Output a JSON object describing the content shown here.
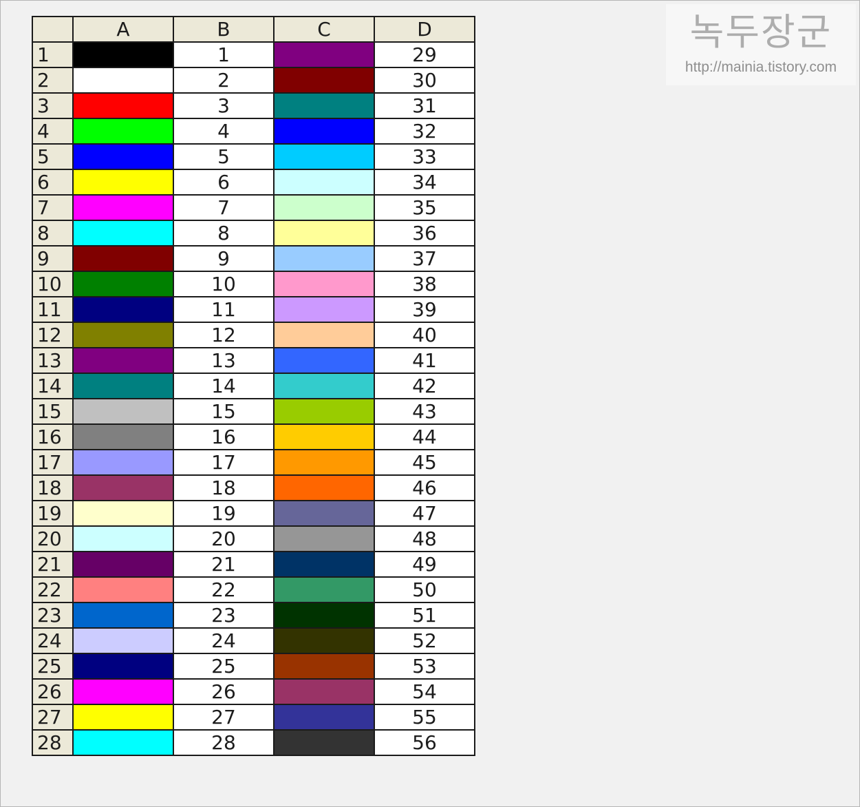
{
  "sheet": {
    "columns": [
      "A",
      "B",
      "C",
      "D"
    ],
    "rows": [
      {
        "n": "1",
        "a_color": "#000000",
        "b": "1",
        "c_color": "#800080",
        "d": "29"
      },
      {
        "n": "2",
        "a_color": "#FFFFFF",
        "b": "2",
        "c_color": "#800000",
        "d": "30"
      },
      {
        "n": "3",
        "a_color": "#FF0000",
        "b": "3",
        "c_color": "#008080",
        "d": "31"
      },
      {
        "n": "4",
        "a_color": "#00FF00",
        "b": "4",
        "c_color": "#0000FF",
        "d": "32"
      },
      {
        "n": "5",
        "a_color": "#0000FF",
        "b": "5",
        "c_color": "#00CCFF",
        "d": "33"
      },
      {
        "n": "6",
        "a_color": "#FFFF00",
        "b": "6",
        "c_color": "#CCFFFF",
        "d": "34"
      },
      {
        "n": "7",
        "a_color": "#FF00FF",
        "b": "7",
        "c_color": "#CCFFCC",
        "d": "35"
      },
      {
        "n": "8",
        "a_color": "#00FFFF",
        "b": "8",
        "c_color": "#FFFF99",
        "d": "36"
      },
      {
        "n": "9",
        "a_color": "#800000",
        "b": "9",
        "c_color": "#99CCFF",
        "d": "37"
      },
      {
        "n": "10",
        "a_color": "#008000",
        "b": "10",
        "c_color": "#FF99CC",
        "d": "38"
      },
      {
        "n": "11",
        "a_color": "#000080",
        "b": "11",
        "c_color": "#CC99FF",
        "d": "39"
      },
      {
        "n": "12",
        "a_color": "#808000",
        "b": "12",
        "c_color": "#FFCC99",
        "d": "40"
      },
      {
        "n": "13",
        "a_color": "#800080",
        "b": "13",
        "c_color": "#3366FF",
        "d": "41"
      },
      {
        "n": "14",
        "a_color": "#008080",
        "b": "14",
        "c_color": "#33CCCC",
        "d": "42"
      },
      {
        "n": "15",
        "a_color": "#C0C0C0",
        "b": "15",
        "c_color": "#99CC00",
        "d": "43"
      },
      {
        "n": "16",
        "a_color": "#808080",
        "b": "16",
        "c_color": "#FFCC00",
        "d": "44"
      },
      {
        "n": "17",
        "a_color": "#9999FF",
        "b": "17",
        "c_color": "#FF9900",
        "d": "45"
      },
      {
        "n": "18",
        "a_color": "#993366",
        "b": "18",
        "c_color": "#FF6600",
        "d": "46"
      },
      {
        "n": "19",
        "a_color": "#FFFFCC",
        "b": "19",
        "c_color": "#666699",
        "d": "47"
      },
      {
        "n": "20",
        "a_color": "#CCFFFF",
        "b": "20",
        "c_color": "#969696",
        "d": "48"
      },
      {
        "n": "21",
        "a_color": "#660066",
        "b": "21",
        "c_color": "#003366",
        "d": "49"
      },
      {
        "n": "22",
        "a_color": "#FF8080",
        "b": "22",
        "c_color": "#339966",
        "d": "50"
      },
      {
        "n": "23",
        "a_color": "#0066CC",
        "b": "23",
        "c_color": "#003300",
        "d": "51"
      },
      {
        "n": "24",
        "a_color": "#CCCCFF",
        "b": "24",
        "c_color": "#333300",
        "d": "52"
      },
      {
        "n": "25",
        "a_color": "#000080",
        "b": "25",
        "c_color": "#993300",
        "d": "53"
      },
      {
        "n": "26",
        "a_color": "#FF00FF",
        "b": "26",
        "c_color": "#993366",
        "d": "54"
      },
      {
        "n": "27",
        "a_color": "#FFFF00",
        "b": "27",
        "c_color": "#333399",
        "d": "55"
      },
      {
        "n": "28",
        "a_color": "#00FFFF",
        "b": "28",
        "c_color": "#333333",
        "d": "56"
      }
    ]
  },
  "watermark": {
    "title": "녹두장군",
    "url": "http://mainia.tistory.com"
  }
}
